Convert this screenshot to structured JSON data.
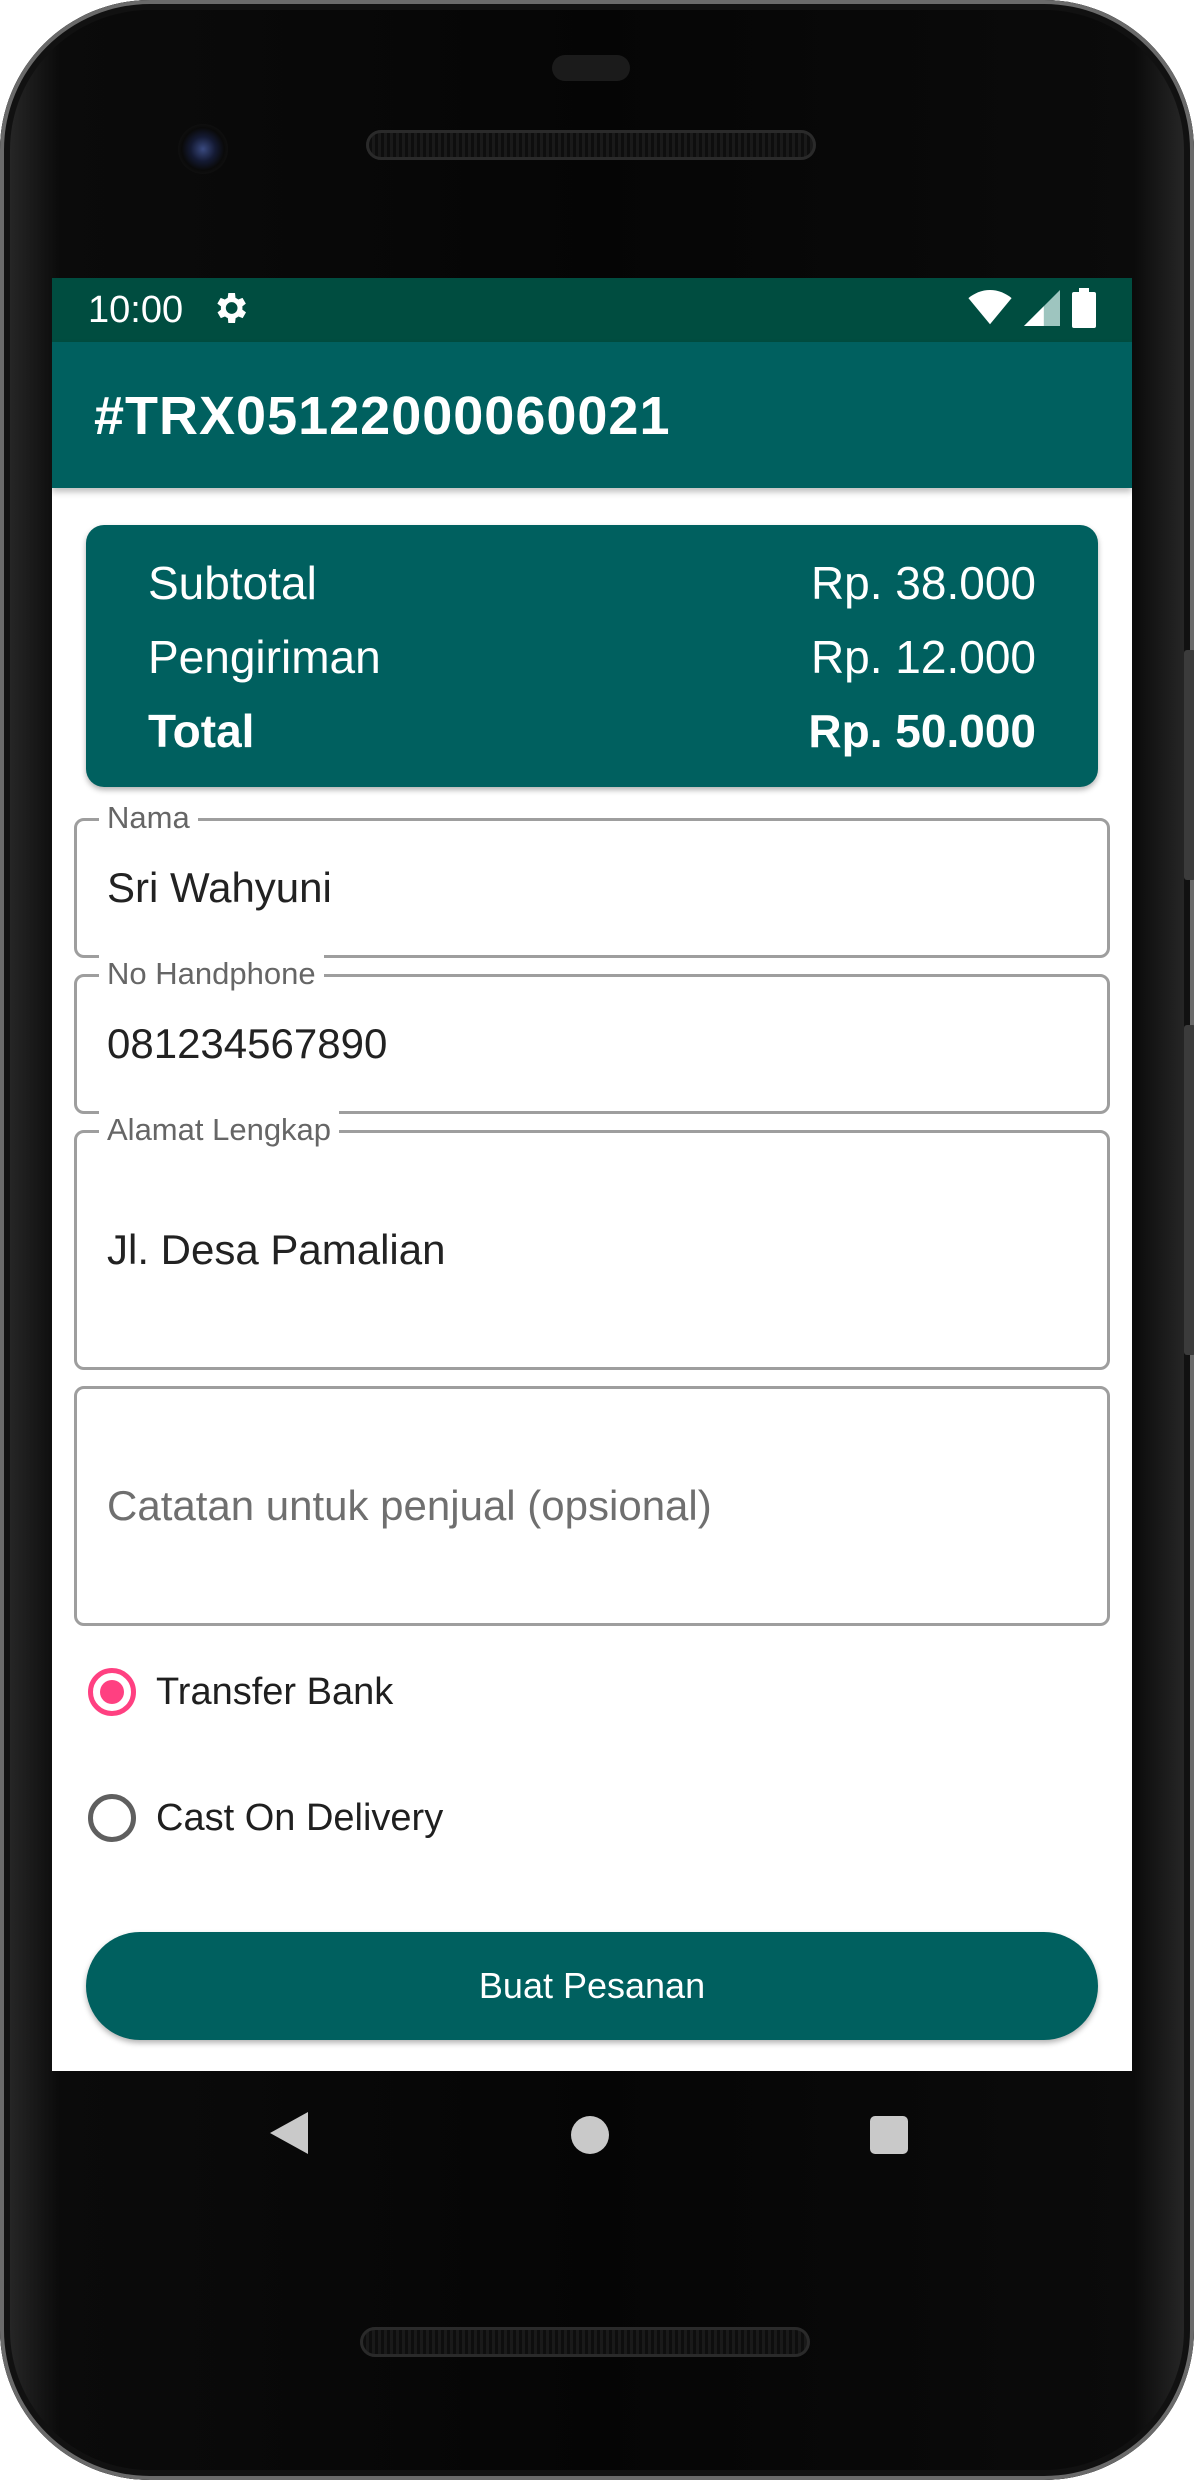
{
  "status_bar": {
    "time": "10:00",
    "icons": [
      "settings-icon",
      "wifi-icon",
      "signal-icon",
      "battery-icon"
    ]
  },
  "app_bar": {
    "title": "#TRX05122000060021"
  },
  "summary": {
    "subtotal_label": "Subtotal",
    "subtotal_value": "Rp. 38.000",
    "shipping_label": "Pengiriman",
    "shipping_value": "Rp. 12.000",
    "total_label": "Total",
    "total_value": "Rp. 50.000"
  },
  "form": {
    "name": {
      "label": "Nama",
      "value": "Sri Wahyuni"
    },
    "phone": {
      "label": "No Handphone",
      "value": "081234567890"
    },
    "address": {
      "label": "Alamat Lengkap",
      "value": "Jl. Desa Pamalian"
    },
    "notes": {
      "placeholder": "Catatan untuk penjual (opsional)"
    }
  },
  "payment": {
    "options": [
      {
        "label": "Transfer Bank",
        "selected": true
      },
      {
        "label": "Cast On Delivery",
        "selected": false
      }
    ]
  },
  "submit_label": "Buat Pesanan",
  "nav": {
    "icons": [
      "back-icon",
      "home-icon",
      "recents-icon"
    ]
  },
  "colors": {
    "primary": "#00605f",
    "status_bar": "#004d40",
    "accent": "#ff4081"
  }
}
